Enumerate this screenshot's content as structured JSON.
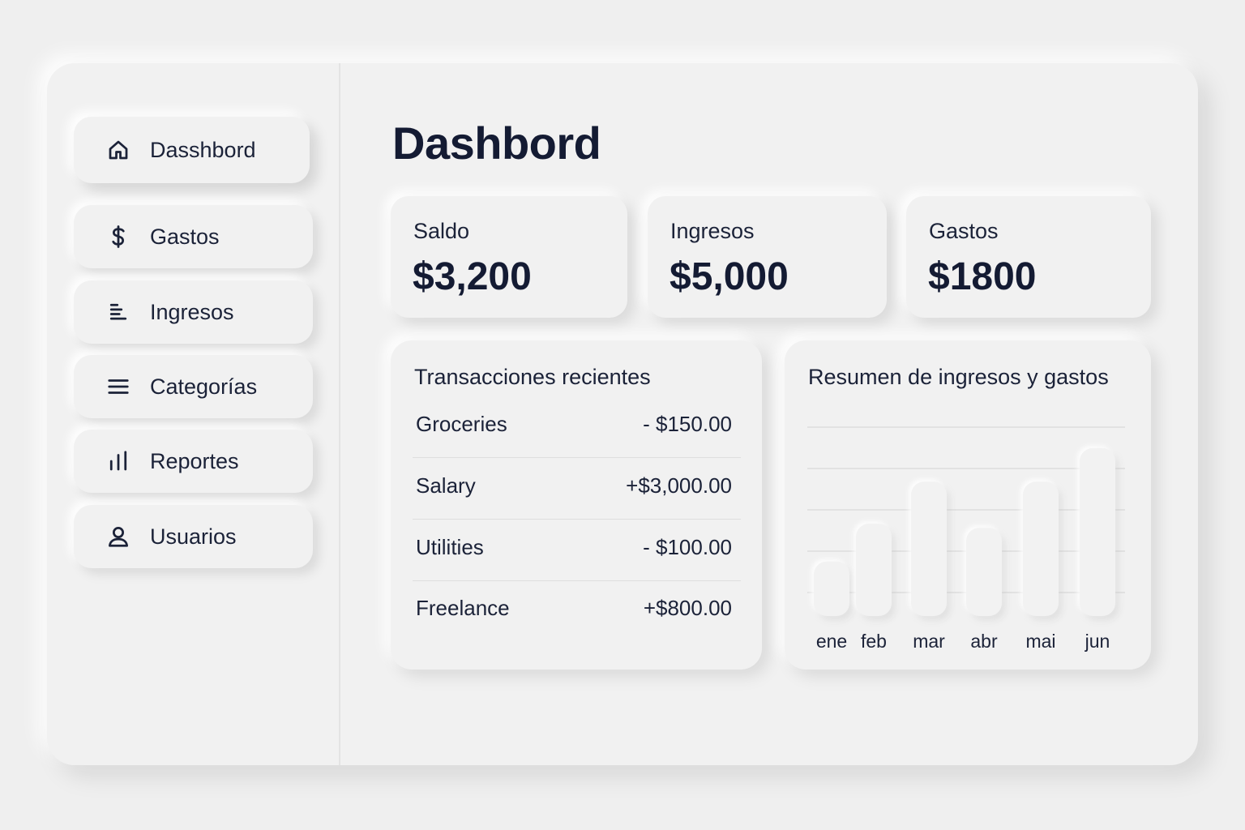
{
  "sidebar": {
    "items": [
      {
        "label": "Dasshbord",
        "icon": "home-icon",
        "active": true
      },
      {
        "label": "Gastos",
        "icon": "dollar-icon"
      },
      {
        "label": "Ingresos",
        "icon": "list-icon"
      },
      {
        "label": "Categorías",
        "icon": "menu-icon"
      },
      {
        "label": "Reportes",
        "icon": "bar-chart-icon"
      },
      {
        "label": "Usuarios",
        "icon": "user-icon"
      }
    ]
  },
  "main": {
    "title": "Dashbord",
    "stats": [
      {
        "label": "Saldo",
        "value": "$3,200"
      },
      {
        "label": "Ingresos",
        "value": "$5,000"
      },
      {
        "label": "Gastos",
        "value": "$1800"
      }
    ],
    "transactions": {
      "title": "Transacciones recientes",
      "rows": [
        {
          "name": "Groceries",
          "amount": "- $150.00"
        },
        {
          "name": "Salary",
          "amount": "+$3,000.00"
        },
        {
          "name": "Utilities",
          "amount": "- $100.00"
        },
        {
          "name": "Freelance",
          "amount": "+$800.00"
        }
      ]
    }
  },
  "chart_data": {
    "type": "bar",
    "title": "Resumen de ingresos y gastos",
    "categories": [
      "ene",
      "feb",
      "mar",
      "abr",
      "mai",
      "jun"
    ],
    "values": [
      1.3,
      2.2,
      3.2,
      2.1,
      3.2,
      4.0
    ],
    "ylim": [
      0,
      4.5
    ],
    "grid": true,
    "xlabel": "",
    "ylabel": ""
  },
  "colors": {
    "background": "#efefef",
    "surface": "#f1f1f1",
    "text": "#1b2238"
  }
}
